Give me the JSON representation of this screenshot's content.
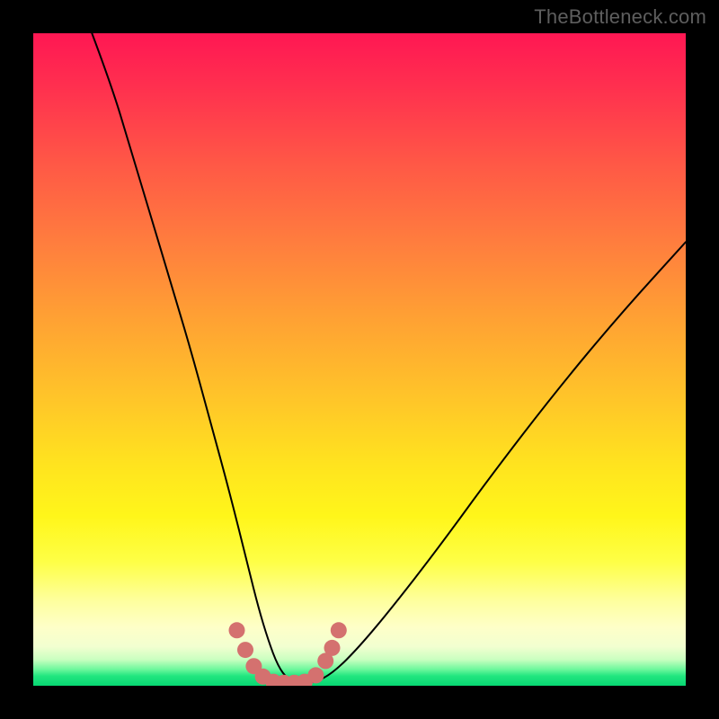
{
  "watermark": "TheBottleneck.com",
  "chart_data": {
    "type": "line",
    "title": "",
    "xlabel": "",
    "ylabel": "",
    "xlim": [
      0,
      100
    ],
    "ylim": [
      0,
      100
    ],
    "series": [
      {
        "name": "curve",
        "x_pct": [
          9,
          12,
          15,
          18,
          21,
          24,
          27,
          30,
          33,
          34.5,
          36,
          37.5,
          39,
          40.5,
          43,
          46,
          50,
          55,
          62,
          70,
          80,
          90,
          100
        ],
        "y_pct": [
          100,
          92,
          82,
          72,
          62,
          52,
          41,
          30,
          18,
          12,
          7,
          3,
          1,
          0.4,
          0.4,
          2,
          6,
          12,
          21,
          32,
          45,
          57,
          68
        ],
        "note": "y_pct is percent of chart height measured from the bottom (0 = bottom/green, 100 = top/red). Values estimated from the figure. No axis ticks or labels are visible."
      }
    ],
    "highlight": {
      "name": "valley-markers",
      "count": 12,
      "approx_x_pct_range": [
        31,
        47
      ],
      "approx_y_pct_range": [
        0.3,
        9
      ],
      "color": "#d4716f"
    },
    "gradient_stops_top_to_bottom": [
      "#ff1753",
      "#ff5846",
      "#ffa233",
      "#ffe31f",
      "#feff46",
      "#feffc8",
      "#6cf79c",
      "#07d772"
    ]
  }
}
